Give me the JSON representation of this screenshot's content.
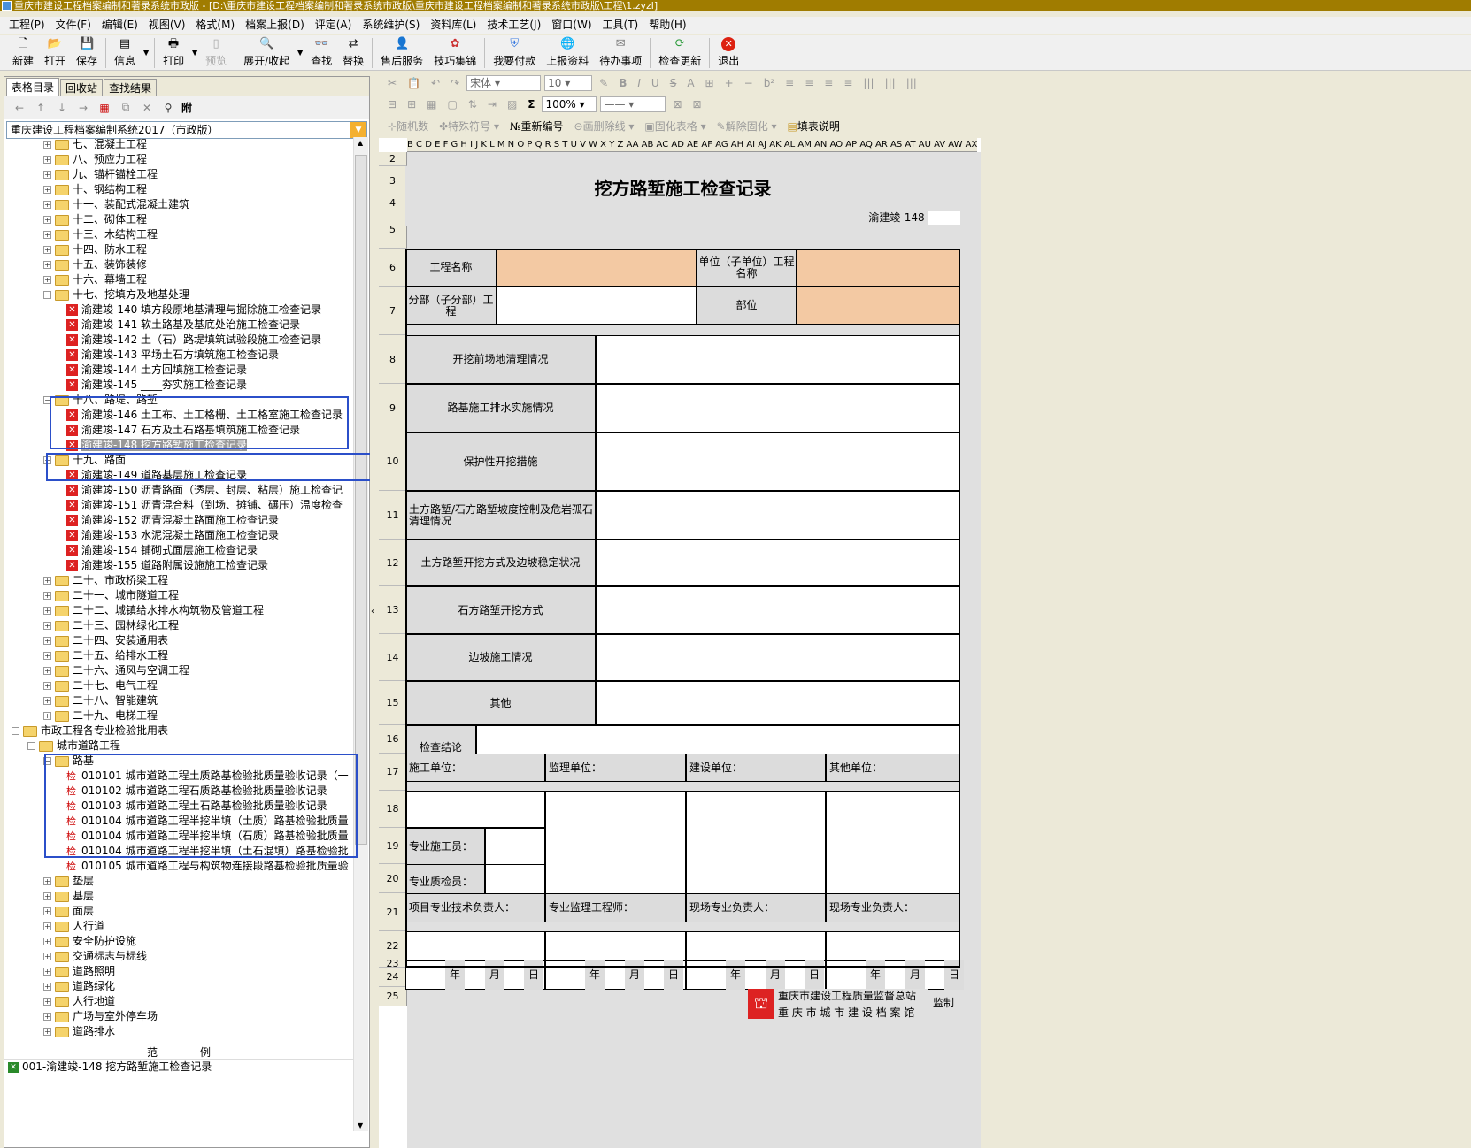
{
  "window": {
    "title": "重庆市建设工程档案编制和著录系统市政版 - [D:\\重庆市建设工程档案编制和著录系统市政版\\重庆市建设工程档案编制和著录系统市政版\\工程\\1.zyzl]"
  },
  "menu": [
    "工程(P)",
    "文件(F)",
    "编辑(E)",
    "视图(V)",
    "格式(M)",
    "档案上报(D)",
    "评定(A)",
    "系统维护(S)",
    "资料库(L)",
    "技术工艺(J)",
    "窗口(W)",
    "工具(T)",
    "帮助(H)"
  ],
  "toolbar": {
    "new": "新建",
    "open": "打开",
    "save": "保存",
    "info": "信息",
    "print": "打印",
    "preview": "预览",
    "expand": "展开/收起",
    "find": "查找",
    "replace": "替换",
    "service": "售后服务",
    "tips": "技巧集锦",
    "pay": "我要付款",
    "upload": "上报资料",
    "todo": "待办事项",
    "update": "检查更新",
    "exit": "退出"
  },
  "left": {
    "tabs": [
      "表格目录",
      "回收站",
      "查找结果"
    ],
    "attach_label": "附",
    "combo_value": "重庆建设工程档案编制系统2017（市政版）",
    "tree": [
      {
        "t": "f",
        "lvl": 1,
        "text": "七、混凝土工程",
        "exp": "+"
      },
      {
        "t": "f",
        "lvl": 1,
        "text": "八、预应力工程",
        "exp": "+"
      },
      {
        "t": "f",
        "lvl": 1,
        "text": "九、锚杆锚栓工程",
        "exp": "+"
      },
      {
        "t": "f",
        "lvl": 1,
        "text": "十、钢结构工程",
        "exp": "+"
      },
      {
        "t": "f",
        "lvl": 1,
        "text": "十一、装配式混凝土建筑",
        "exp": "+"
      },
      {
        "t": "f",
        "lvl": 1,
        "text": "十二、砌体工程",
        "exp": "+"
      },
      {
        "t": "f",
        "lvl": 1,
        "text": "十三、木结构工程",
        "exp": "+"
      },
      {
        "t": "f",
        "lvl": 1,
        "text": "十四、防水工程",
        "exp": "+"
      },
      {
        "t": "f",
        "lvl": 1,
        "text": "十五、装饰装修",
        "exp": "+"
      },
      {
        "t": "f",
        "lvl": 1,
        "text": "十六、幕墙工程",
        "exp": "+"
      },
      {
        "t": "f",
        "lvl": 1,
        "text": "十七、挖填方及地基处理",
        "exp": "-"
      },
      {
        "t": "x",
        "lvl": 2,
        "text": "渝建竣-140 填方段原地基清理与掘除施工检查记录"
      },
      {
        "t": "x",
        "lvl": 2,
        "text": "渝建竣-141 软土路基及基底处治施工检查记录"
      },
      {
        "t": "x",
        "lvl": 2,
        "text": "渝建竣-142 土（石）路堤填筑试验段施工检查记录"
      },
      {
        "t": "x",
        "lvl": 2,
        "text": "渝建竣-143 平场土石方填筑施工检查记录"
      },
      {
        "t": "x",
        "lvl": 2,
        "text": "渝建竣-144 土方回填施工检查记录"
      },
      {
        "t": "x",
        "lvl": 2,
        "text": "渝建竣-145 ____夯实施工检查记录"
      },
      {
        "t": "f",
        "lvl": 1,
        "text": "十八、路堤、路堑",
        "exp": "-"
      },
      {
        "t": "x",
        "lvl": 2,
        "text": "渝建竣-146 土工布、土工格栅、土工格室施工检查记录"
      },
      {
        "t": "x",
        "lvl": 2,
        "text": "渝建竣-147 石方及土石路基填筑施工检查记录"
      },
      {
        "t": "x",
        "lvl": 2,
        "text": "渝建竣-148 挖方路堑施工检查记录",
        "sel": true
      },
      {
        "t": "f",
        "lvl": 1,
        "text": "十九、路面",
        "exp": "-"
      },
      {
        "t": "x",
        "lvl": 2,
        "text": "渝建竣-149 道路基层施工检查记录"
      },
      {
        "t": "x",
        "lvl": 2,
        "text": "渝建竣-150 沥青路面（透层、封层、粘层）施工检查记"
      },
      {
        "t": "x",
        "lvl": 2,
        "text": "渝建竣-151 沥青混合料（到场、摊铺、碾压）温度检查"
      },
      {
        "t": "x",
        "lvl": 2,
        "text": "渝建竣-152 沥青混凝土路面施工检查记录"
      },
      {
        "t": "x",
        "lvl": 2,
        "text": "渝建竣-153 水泥混凝土路面施工检查记录"
      },
      {
        "t": "x",
        "lvl": 2,
        "text": "渝建竣-154 铺砌式面层施工检查记录"
      },
      {
        "t": "x",
        "lvl": 2,
        "text": "渝建竣-155 道路附属设施施工检查记录"
      },
      {
        "t": "f",
        "lvl": 1,
        "text": "二十、市政桥梁工程",
        "exp": "+"
      },
      {
        "t": "f",
        "lvl": 1,
        "text": "二十一、城市隧道工程",
        "exp": "+"
      },
      {
        "t": "f",
        "lvl": 1,
        "text": "二十二、城镇给水排水构筑物及管道工程",
        "exp": "+"
      },
      {
        "t": "f",
        "lvl": 1,
        "text": "二十三、园林绿化工程",
        "exp": "+"
      },
      {
        "t": "f",
        "lvl": 1,
        "text": "二十四、安装通用表",
        "exp": "+"
      },
      {
        "t": "f",
        "lvl": 1,
        "text": "二十五、给排水工程",
        "exp": "+"
      },
      {
        "t": "f",
        "lvl": 1,
        "text": "二十六、通风与空调工程",
        "exp": "+"
      },
      {
        "t": "f",
        "lvl": 1,
        "text": "二十七、电气工程",
        "exp": "+"
      },
      {
        "t": "f",
        "lvl": 1,
        "text": "二十八、智能建筑",
        "exp": "+"
      },
      {
        "t": "f",
        "lvl": 1,
        "text": "二十九、电梯工程",
        "exp": "+"
      },
      {
        "t": "f",
        "lvl": -1,
        "text": "市政工程各专业检验批用表",
        "exp": "-"
      },
      {
        "t": "f",
        "lvl": 0,
        "text": "城市道路工程",
        "exp": "-"
      },
      {
        "t": "f",
        "lvl": 1,
        "text": "路基",
        "exp": "-"
      },
      {
        "t": "k",
        "lvl": 2,
        "text": "010101 城市道路工程土质路基检验批质量验收记录（一"
      },
      {
        "t": "k",
        "lvl": 2,
        "text": "010102 城市道路工程石质路基检验批质量验收记录"
      },
      {
        "t": "k",
        "lvl": 2,
        "text": "010103 城市道路工程土石路基检验批质量验收记录"
      },
      {
        "t": "k",
        "lvl": 2,
        "text": "010104 城市道路工程半挖半填（土质）路基检验批质量"
      },
      {
        "t": "k",
        "lvl": 2,
        "text": "010104 城市道路工程半挖半填（石质）路基检验批质量"
      },
      {
        "t": "k",
        "lvl": 2,
        "text": "010104 城市道路工程半挖半填（土石混填）路基检验批"
      },
      {
        "t": "k",
        "lvl": 2,
        "text": "010105 城市道路工程与构筑物连接段路基检验批质量验"
      },
      {
        "t": "f",
        "lvl": 1,
        "text": "垫层",
        "exp": "+"
      },
      {
        "t": "f",
        "lvl": 1,
        "text": "基层",
        "exp": "+"
      },
      {
        "t": "f",
        "lvl": 1,
        "text": "面层",
        "exp": "+"
      },
      {
        "t": "f",
        "lvl": 1,
        "text": "人行道",
        "exp": "+"
      },
      {
        "t": "f",
        "lvl": 1,
        "text": "安全防护设施",
        "exp": "+"
      },
      {
        "t": "f",
        "lvl": 1,
        "text": "交通标志与标线",
        "exp": "+"
      },
      {
        "t": "f",
        "lvl": 1,
        "text": "道路照明",
        "exp": "+"
      },
      {
        "t": "f",
        "lvl": 1,
        "text": "道路绿化",
        "exp": "+"
      },
      {
        "t": "f",
        "lvl": 1,
        "text": "人行地道",
        "exp": "+"
      },
      {
        "t": "f",
        "lvl": 1,
        "text": "广场与室外停车场",
        "exp": "+"
      },
      {
        "t": "f",
        "lvl": 1,
        "text": "道路排水",
        "exp": "+"
      }
    ],
    "legend_header": "范　　　　例",
    "legend_item": "001-渝建竣-148 挖方路堑施工检查记录"
  },
  "format": {
    "font": "宋体",
    "size": "10",
    "zoom": "100%",
    "bar3": [
      "随机数",
      "特殊符号",
      "重新编号",
      "画删除线",
      "固化表格",
      "解除固化",
      "填表说明"
    ]
  },
  "sheet": {
    "col_letters": "B C D E F G H I J K L M N O P Q R S T U V W X Y Z AA AB AC AD AE AF AG AH AI AJ AK AL AM AN AO AP AQ AR AS AT AU AV AW AX AY AZ BA BB",
    "row_numbers": [
      "2",
      "3",
      "4",
      "5",
      "6",
      "7",
      "8",
      "9",
      "10",
      "11",
      "12",
      "13",
      "14",
      "15",
      "16",
      "17",
      "18",
      "19",
      "20",
      "21",
      "22",
      "23",
      "24",
      "25"
    ],
    "title": "挖方路堑施工检查记录",
    "code": "渝建竣-148-",
    "project_name": "工程名称",
    "unit_name": "单位（子单位）工程名称",
    "division": "分部（子分部）工程",
    "part": "部位",
    "items": [
      "开挖前场地清理情况",
      "路基施工排水实施情况",
      "保护性开挖措施",
      "土方路堑/石方路堑坡度控制及危岩孤石清理情况",
      "土方路堑开挖方式及边坡稳定状况",
      "石方路堑开挖方式",
      "边坡施工情况",
      "其他"
    ],
    "conclusion": "检查结论",
    "sign_units": [
      "施工单位：",
      "监理单位：",
      "建设单位：",
      "其他单位："
    ],
    "construction_staff": "专业施工员：",
    "quality_inspector": "专业质检员：",
    "sign_roles": [
      "项目专业技术负责人：",
      "专业监理工程师：",
      "现场专业负责人：",
      "现场专业负责人："
    ],
    "date": {
      "y": "年",
      "m": "月",
      "d": "日"
    },
    "footer1": "重庆市建设工程质量监督总站",
    "footer2": "重 庆 市 城 市 建 设 档 案 馆",
    "footer3": "监制"
  },
  "colors": {
    "title_bar": "#a07c00",
    "orange_cell": "#f3c9a3",
    "gray_cell": "#dcdcdc",
    "highlight": "#2b4fc9"
  }
}
